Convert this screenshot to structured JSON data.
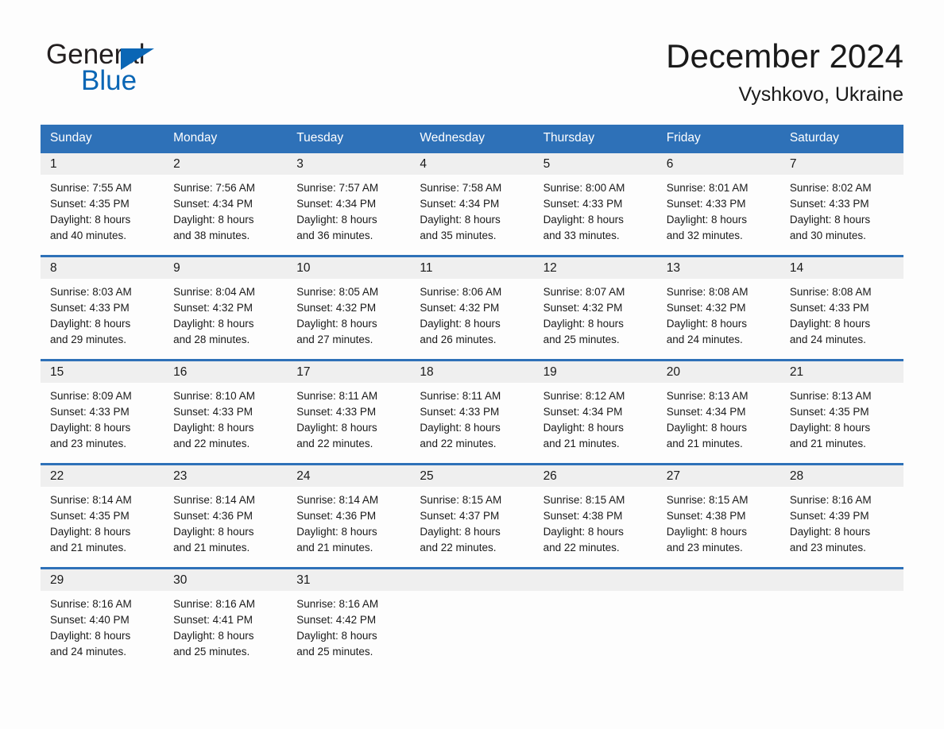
{
  "brand": {
    "name_part1": "General",
    "name_part2": "Blue",
    "triangle_icon": "triangle-icon",
    "accent_color": "#0a66b5"
  },
  "header": {
    "title": "December 2024",
    "subtitle": "Vyshkovo, Ukraine"
  },
  "theme": {
    "header_bar_color": "#2e71b8",
    "daynum_band_color": "#efefef",
    "page_background": "#fdfdfd",
    "text_color": "#1a1a1a"
  },
  "weekdays": [
    "Sunday",
    "Monday",
    "Tuesday",
    "Wednesday",
    "Thursday",
    "Friday",
    "Saturday"
  ],
  "weeks": [
    [
      {
        "day": "1",
        "sunrise": "Sunrise: 7:55 AM",
        "sunset": "Sunset: 4:35 PM",
        "daylight_line1": "Daylight: 8 hours",
        "daylight_line2": "and 40 minutes."
      },
      {
        "day": "2",
        "sunrise": "Sunrise: 7:56 AM",
        "sunset": "Sunset: 4:34 PM",
        "daylight_line1": "Daylight: 8 hours",
        "daylight_line2": "and 38 minutes."
      },
      {
        "day": "3",
        "sunrise": "Sunrise: 7:57 AM",
        "sunset": "Sunset: 4:34 PM",
        "daylight_line1": "Daylight: 8 hours",
        "daylight_line2": "and 36 minutes."
      },
      {
        "day": "4",
        "sunrise": "Sunrise: 7:58 AM",
        "sunset": "Sunset: 4:34 PM",
        "daylight_line1": "Daylight: 8 hours",
        "daylight_line2": "and 35 minutes."
      },
      {
        "day": "5",
        "sunrise": "Sunrise: 8:00 AM",
        "sunset": "Sunset: 4:33 PM",
        "daylight_line1": "Daylight: 8 hours",
        "daylight_line2": "and 33 minutes."
      },
      {
        "day": "6",
        "sunrise": "Sunrise: 8:01 AM",
        "sunset": "Sunset: 4:33 PM",
        "daylight_line1": "Daylight: 8 hours",
        "daylight_line2": "and 32 minutes."
      },
      {
        "day": "7",
        "sunrise": "Sunrise: 8:02 AM",
        "sunset": "Sunset: 4:33 PM",
        "daylight_line1": "Daylight: 8 hours",
        "daylight_line2": "and 30 minutes."
      }
    ],
    [
      {
        "day": "8",
        "sunrise": "Sunrise: 8:03 AM",
        "sunset": "Sunset: 4:33 PM",
        "daylight_line1": "Daylight: 8 hours",
        "daylight_line2": "and 29 minutes."
      },
      {
        "day": "9",
        "sunrise": "Sunrise: 8:04 AM",
        "sunset": "Sunset: 4:32 PM",
        "daylight_line1": "Daylight: 8 hours",
        "daylight_line2": "and 28 minutes."
      },
      {
        "day": "10",
        "sunrise": "Sunrise: 8:05 AM",
        "sunset": "Sunset: 4:32 PM",
        "daylight_line1": "Daylight: 8 hours",
        "daylight_line2": "and 27 minutes."
      },
      {
        "day": "11",
        "sunrise": "Sunrise: 8:06 AM",
        "sunset": "Sunset: 4:32 PM",
        "daylight_line1": "Daylight: 8 hours",
        "daylight_line2": "and 26 minutes."
      },
      {
        "day": "12",
        "sunrise": "Sunrise: 8:07 AM",
        "sunset": "Sunset: 4:32 PM",
        "daylight_line1": "Daylight: 8 hours",
        "daylight_line2": "and 25 minutes."
      },
      {
        "day": "13",
        "sunrise": "Sunrise: 8:08 AM",
        "sunset": "Sunset: 4:32 PM",
        "daylight_line1": "Daylight: 8 hours",
        "daylight_line2": "and 24 minutes."
      },
      {
        "day": "14",
        "sunrise": "Sunrise: 8:08 AM",
        "sunset": "Sunset: 4:33 PM",
        "daylight_line1": "Daylight: 8 hours",
        "daylight_line2": "and 24 minutes."
      }
    ],
    [
      {
        "day": "15",
        "sunrise": "Sunrise: 8:09 AM",
        "sunset": "Sunset: 4:33 PM",
        "daylight_line1": "Daylight: 8 hours",
        "daylight_line2": "and 23 minutes."
      },
      {
        "day": "16",
        "sunrise": "Sunrise: 8:10 AM",
        "sunset": "Sunset: 4:33 PM",
        "daylight_line1": "Daylight: 8 hours",
        "daylight_line2": "and 22 minutes."
      },
      {
        "day": "17",
        "sunrise": "Sunrise: 8:11 AM",
        "sunset": "Sunset: 4:33 PM",
        "daylight_line1": "Daylight: 8 hours",
        "daylight_line2": "and 22 minutes."
      },
      {
        "day": "18",
        "sunrise": "Sunrise: 8:11 AM",
        "sunset": "Sunset: 4:33 PM",
        "daylight_line1": "Daylight: 8 hours",
        "daylight_line2": "and 22 minutes."
      },
      {
        "day": "19",
        "sunrise": "Sunrise: 8:12 AM",
        "sunset": "Sunset: 4:34 PM",
        "daylight_line1": "Daylight: 8 hours",
        "daylight_line2": "and 21 minutes."
      },
      {
        "day": "20",
        "sunrise": "Sunrise: 8:13 AM",
        "sunset": "Sunset: 4:34 PM",
        "daylight_line1": "Daylight: 8 hours",
        "daylight_line2": "and 21 minutes."
      },
      {
        "day": "21",
        "sunrise": "Sunrise: 8:13 AM",
        "sunset": "Sunset: 4:35 PM",
        "daylight_line1": "Daylight: 8 hours",
        "daylight_line2": "and 21 minutes."
      }
    ],
    [
      {
        "day": "22",
        "sunrise": "Sunrise: 8:14 AM",
        "sunset": "Sunset: 4:35 PM",
        "daylight_line1": "Daylight: 8 hours",
        "daylight_line2": "and 21 minutes."
      },
      {
        "day": "23",
        "sunrise": "Sunrise: 8:14 AM",
        "sunset": "Sunset: 4:36 PM",
        "daylight_line1": "Daylight: 8 hours",
        "daylight_line2": "and 21 minutes."
      },
      {
        "day": "24",
        "sunrise": "Sunrise: 8:14 AM",
        "sunset": "Sunset: 4:36 PM",
        "daylight_line1": "Daylight: 8 hours",
        "daylight_line2": "and 21 minutes."
      },
      {
        "day": "25",
        "sunrise": "Sunrise: 8:15 AM",
        "sunset": "Sunset: 4:37 PM",
        "daylight_line1": "Daylight: 8 hours",
        "daylight_line2": "and 22 minutes."
      },
      {
        "day": "26",
        "sunrise": "Sunrise: 8:15 AM",
        "sunset": "Sunset: 4:38 PM",
        "daylight_line1": "Daylight: 8 hours",
        "daylight_line2": "and 22 minutes."
      },
      {
        "day": "27",
        "sunrise": "Sunrise: 8:15 AM",
        "sunset": "Sunset: 4:38 PM",
        "daylight_line1": "Daylight: 8 hours",
        "daylight_line2": "and 23 minutes."
      },
      {
        "day": "28",
        "sunrise": "Sunrise: 8:16 AM",
        "sunset": "Sunset: 4:39 PM",
        "daylight_line1": "Daylight: 8 hours",
        "daylight_line2": "and 23 minutes."
      }
    ],
    [
      {
        "day": "29",
        "sunrise": "Sunrise: 8:16 AM",
        "sunset": "Sunset: 4:40 PM",
        "daylight_line1": "Daylight: 8 hours",
        "daylight_line2": "and 24 minutes."
      },
      {
        "day": "30",
        "sunrise": "Sunrise: 8:16 AM",
        "sunset": "Sunset: 4:41 PM",
        "daylight_line1": "Daylight: 8 hours",
        "daylight_line2": "and 25 minutes."
      },
      {
        "day": "31",
        "sunrise": "Sunrise: 8:16 AM",
        "sunset": "Sunset: 4:42 PM",
        "daylight_line1": "Daylight: 8 hours",
        "daylight_line2": "and 25 minutes."
      },
      {
        "day": "",
        "sunrise": "",
        "sunset": "",
        "daylight_line1": "",
        "daylight_line2": ""
      },
      {
        "day": "",
        "sunrise": "",
        "sunset": "",
        "daylight_line1": "",
        "daylight_line2": ""
      },
      {
        "day": "",
        "sunrise": "",
        "sunset": "",
        "daylight_line1": "",
        "daylight_line2": ""
      },
      {
        "day": "",
        "sunrise": "",
        "sunset": "",
        "daylight_line1": "",
        "daylight_line2": ""
      }
    ]
  ]
}
